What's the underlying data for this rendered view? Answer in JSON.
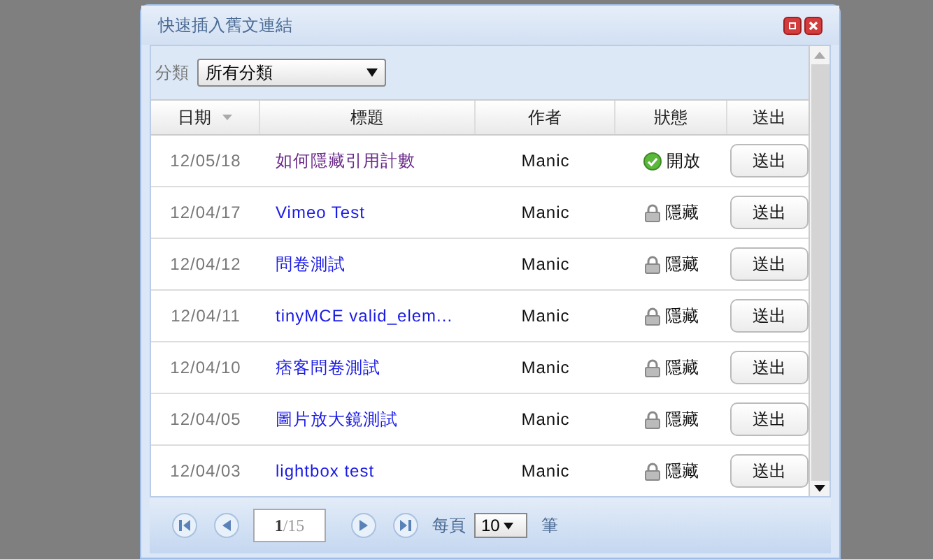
{
  "window": {
    "title": "快速插入舊文連結"
  },
  "filter": {
    "label": "分類",
    "value": "所有分類"
  },
  "table": {
    "columns": [
      "日期",
      "標題",
      "作者",
      "狀態",
      "送出"
    ],
    "rows": [
      {
        "date": "12/05/18",
        "title": "如何隱藏引用計數",
        "visited": true,
        "author": "Manic",
        "status": {
          "kind": "open",
          "label": "開放"
        },
        "action": "送出"
      },
      {
        "date": "12/04/17",
        "title": "Vimeo Test",
        "visited": false,
        "author": "Manic",
        "status": {
          "kind": "hidden",
          "label": "隱藏"
        },
        "action": "送出"
      },
      {
        "date": "12/04/12",
        "title": "問卷測試",
        "visited": false,
        "author": "Manic",
        "status": {
          "kind": "hidden",
          "label": "隱藏"
        },
        "action": "送出"
      },
      {
        "date": "12/04/11",
        "title": "tinyMCE valid_elem...",
        "visited": false,
        "author": "Manic",
        "status": {
          "kind": "hidden",
          "label": "隱藏"
        },
        "action": "送出"
      },
      {
        "date": "12/04/10",
        "title": "痞客問卷測試",
        "visited": false,
        "author": "Manic",
        "status": {
          "kind": "hidden",
          "label": "隱藏"
        },
        "action": "送出"
      },
      {
        "date": "12/04/05",
        "title": "圖片放大鏡測試",
        "visited": false,
        "author": "Manic",
        "status": {
          "kind": "hidden",
          "label": "隱藏"
        },
        "action": "送出"
      },
      {
        "date": "12/04/03",
        "title": "lightbox test",
        "visited": false,
        "author": "Manic",
        "status": {
          "kind": "hidden",
          "label": "隱藏"
        },
        "action": "送出"
      }
    ]
  },
  "pager": {
    "page": "1",
    "total": "/15",
    "per_page_label": "每頁",
    "per_page": "10",
    "unit": "筆"
  }
}
